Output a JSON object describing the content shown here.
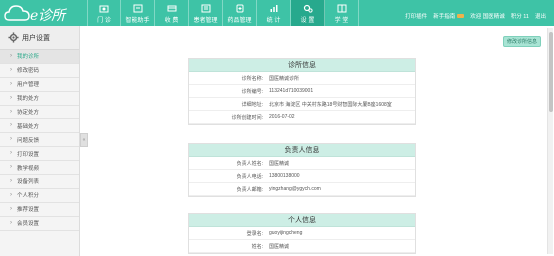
{
  "header": {
    "logo_text": "e诊所",
    "nav": [
      {
        "label": "门 诊",
        "icon": "clinic-icon"
      },
      {
        "label": "智能助手",
        "icon": "assistant-icon"
      },
      {
        "label": "收 费",
        "icon": "charge-icon"
      },
      {
        "label": "患者管理",
        "icon": "patient-icon"
      },
      {
        "label": "药品管理",
        "icon": "drug-icon"
      },
      {
        "label": "统 计",
        "icon": "stats-icon"
      },
      {
        "label": "设 置",
        "icon": "settings-icon"
      },
      {
        "label": "学 堂",
        "icon": "school-icon"
      }
    ],
    "active_index": 6,
    "right": {
      "print": "打印插件",
      "newbie": "新手指南",
      "welcome": "欢迎 国医精诚",
      "points": "积分 11",
      "logout": "退出"
    }
  },
  "sidebar": {
    "title": "用户设置",
    "items": [
      "我的诊所",
      "修改密码",
      "用户管理",
      "我的处方",
      "协定处方",
      "基础处方",
      "问题反馈",
      "打印设置",
      "教学视频",
      "设备列表",
      "个人积分",
      "推荐设置",
      "会员设置"
    ],
    "active_index": 0
  },
  "main": {
    "edit_label": "修改诊所信息",
    "clinic": {
      "title": "诊所信息",
      "rows": [
        {
          "label": "诊所名称:",
          "value": "国医精诚诊所"
        },
        {
          "label": "诊所编号:",
          "value": "113241d710039001"
        },
        {
          "label": "详细地址:",
          "value": "北京市 海淀区 中关村东路18号财智国际大厦B座1608室"
        },
        {
          "label": "诊所创建时间:",
          "value": "2016-07-02"
        }
      ]
    },
    "owner": {
      "title": "负责人信息",
      "rows": [
        {
          "label": "负责人姓名:",
          "value": "国医精诚"
        },
        {
          "label": "负责人电话:",
          "value": "13800138000"
        },
        {
          "label": "负责人邮箱:",
          "value": "yingzhang@ygych.com"
        }
      ]
    },
    "personal": {
      "title": "个人信息",
      "rows": [
        {
          "label": "登录名:",
          "value": "guoyijingcheng"
        },
        {
          "label": "姓名:",
          "value": "国医精诚"
        }
      ]
    }
  },
  "colors": {
    "brand": "#3ec3a6",
    "brand_dark": "#27a98d",
    "card_header": "#cdeee5"
  }
}
